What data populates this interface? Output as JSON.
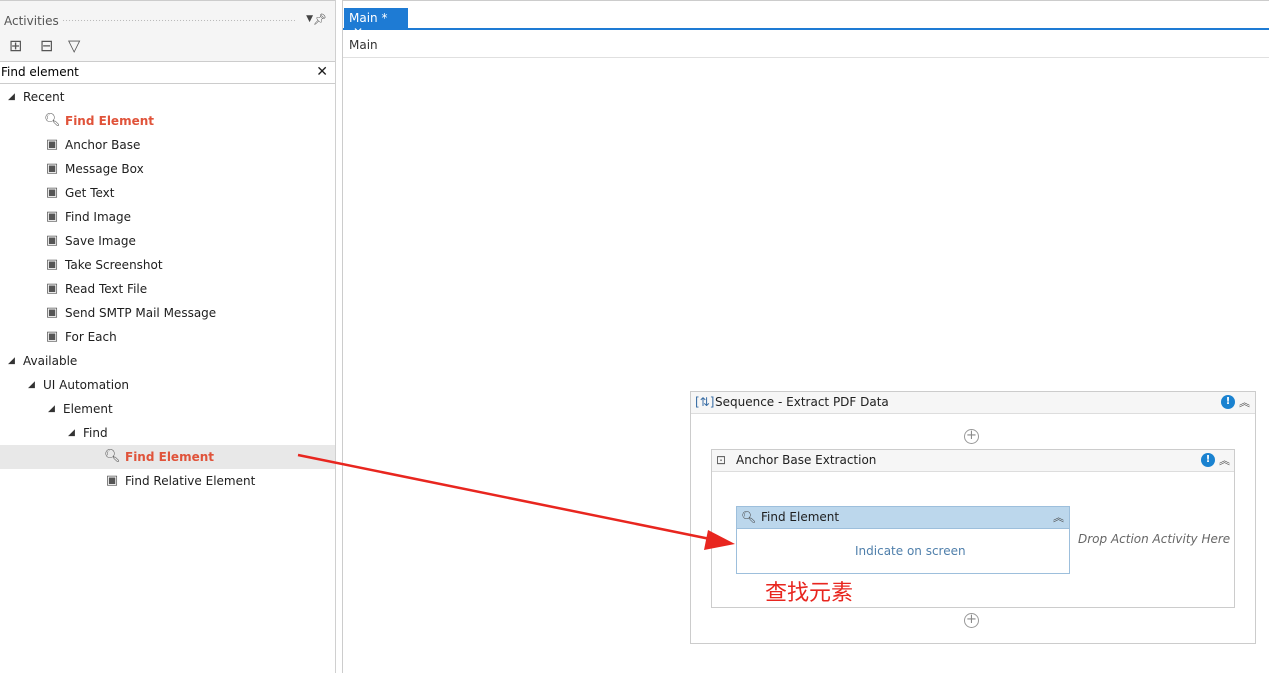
{
  "activities": {
    "title": "Activities",
    "search_value": "Find element",
    "tree": [
      {
        "label": "Recent",
        "level": 0,
        "type": "group"
      },
      {
        "label": "Find Element",
        "level": 1,
        "icon": "search-icon",
        "highlight": true
      },
      {
        "label": "Anchor Base",
        "level": 1,
        "icon": "anchor-icon"
      },
      {
        "label": "Message Box",
        "level": 1,
        "icon": "message-icon"
      },
      {
        "label": "Get Text",
        "level": 1,
        "icon": "text-icon"
      },
      {
        "label": "Find Image",
        "level": 1,
        "icon": "image-icon"
      },
      {
        "label": "Save Image",
        "level": 1,
        "icon": "save-image-icon"
      },
      {
        "label": "Take Screenshot",
        "level": 1,
        "icon": "screenshot-icon"
      },
      {
        "label": "Read Text File",
        "level": 1,
        "icon": "file-icon"
      },
      {
        "label": "Send SMTP Mail Message",
        "level": 1,
        "icon": "mail-icon"
      },
      {
        "label": "For Each",
        "level": 1,
        "icon": "loop-icon"
      },
      {
        "label": "Available",
        "level": 0,
        "type": "group"
      },
      {
        "label": "UI Automation",
        "level": 1,
        "type": "group"
      },
      {
        "label": "Element",
        "level": 2,
        "type": "group"
      },
      {
        "label": "Find",
        "level": 3,
        "type": "group"
      },
      {
        "label": "Find Element",
        "level": 4,
        "icon": "search-icon",
        "highlight": true,
        "selected": true
      },
      {
        "label": "Find Relative Element",
        "level": 4,
        "icon": "find-relative-icon"
      }
    ]
  },
  "editor": {
    "tab_label": "Main *",
    "breadcrumb": "Main",
    "sequence_title": "Sequence - Extract PDF Data",
    "anchor_title": "Anchor Base Extraction",
    "find_title": "Find Element",
    "indicate_link": "Indicate on screen",
    "drop_hint": "Drop Action Activity Here",
    "annotation": "查找元素"
  },
  "colors": {
    "accent": "#1e7bd4",
    "highlight": "#e0533a",
    "annotation": "#e8261f"
  }
}
